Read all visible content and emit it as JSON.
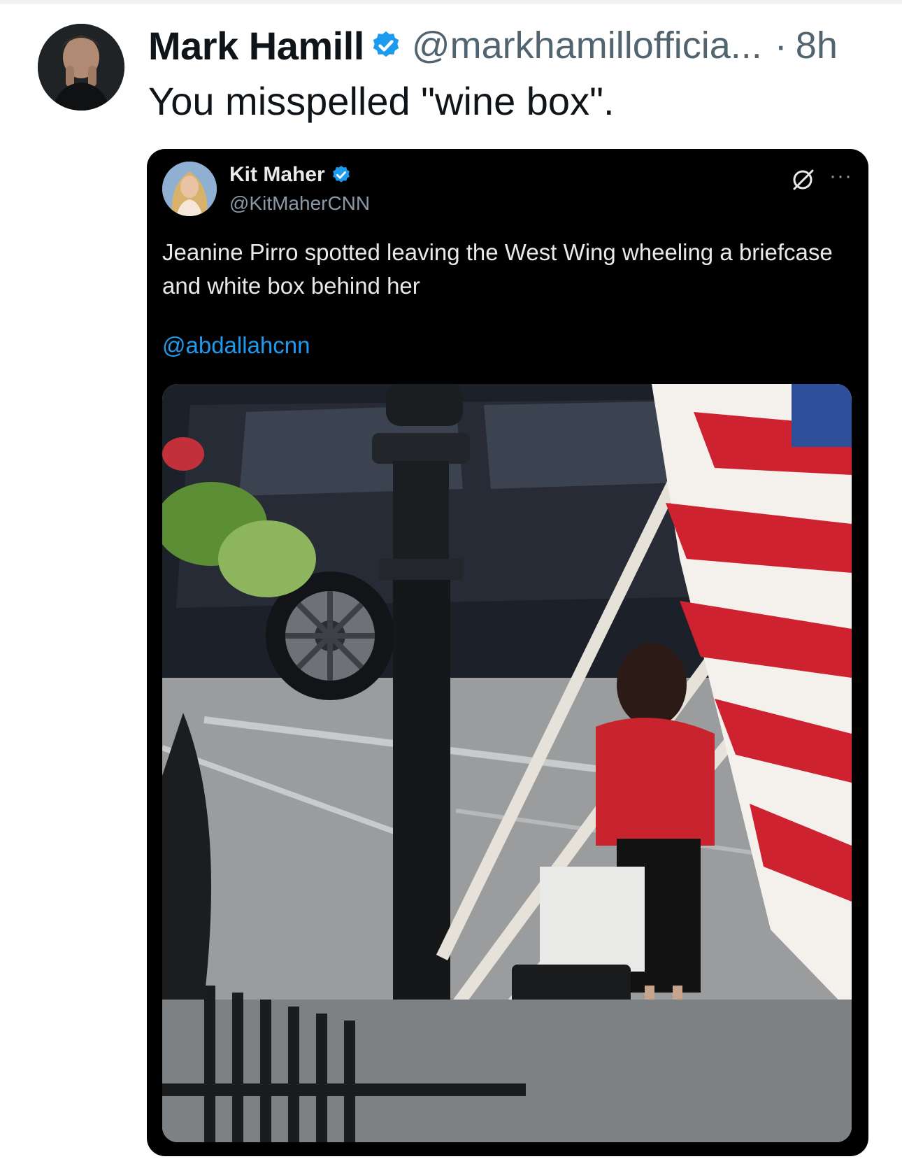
{
  "outer_tweet": {
    "author_name": "Mark Hamill",
    "author_handle": "@markhamillofficia...",
    "separator": "·",
    "time": "8h",
    "text": "You misspelled \"wine box\"."
  },
  "quoted_tweet": {
    "author_name": "Kit Maher",
    "author_handle": "@KitMaherCNN",
    "text": "Jeanine Pirro spotted leaving the West Wing wheeling a briefcase and white box behind her",
    "mention": "@abdallahcnn",
    "more_label": "···",
    "image_icon": "photo"
  },
  "icons": {
    "verified": "verified-badge-icon",
    "grok": "grok-icon",
    "more": "more-icon"
  },
  "colors": {
    "verified_blue": "#1d9bf0",
    "handle_gray": "#536471",
    "quote_background": "#000000",
    "link_blue": "#1d9bf0"
  }
}
